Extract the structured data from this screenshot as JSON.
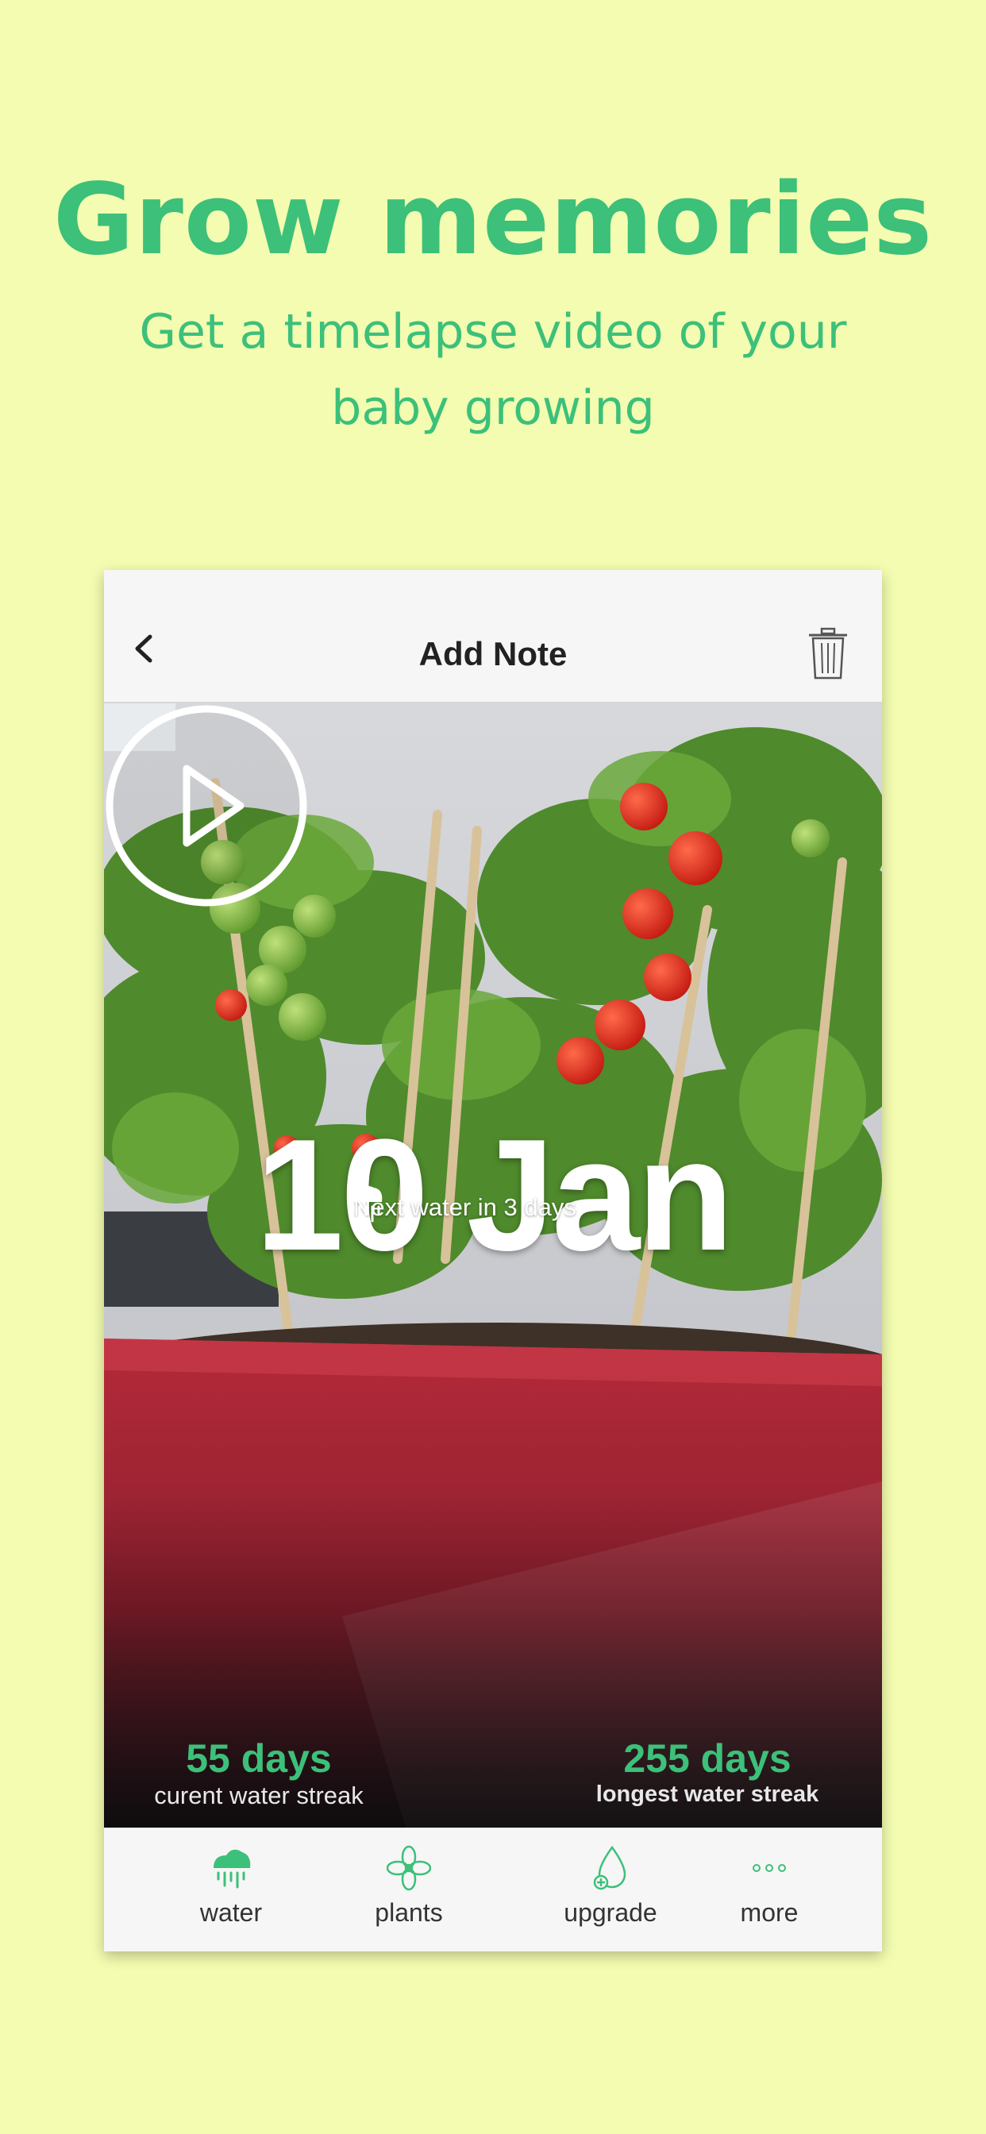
{
  "promo": {
    "headline": "Grow memories",
    "subheadline": "Get a timelapse video of your baby growing"
  },
  "navbar": {
    "title": "Add Note",
    "back_icon": "chevron-left-icon",
    "delete_icon": "trash-icon"
  },
  "plant_card": {
    "date": "10 Jan",
    "next_water": "Next water in 3 days",
    "next_water_icon": "rain-cloud-icon",
    "play_icon": "play-icon"
  },
  "streaks": {
    "current": {
      "value": "55 days",
      "label": "curent water streak"
    },
    "longest": {
      "value": "255 days",
      "label": "longest water streak"
    }
  },
  "tabs": [
    {
      "label": "water",
      "icon": "rain-cloud-icon",
      "active": true
    },
    {
      "label": "plants",
      "icon": "flower-icon"
    },
    {
      "label": "upgrade",
      "icon": "water-drop-plus-icon"
    },
    {
      "label": "more",
      "icon": "more-dots-icon"
    }
  ],
  "colors": {
    "background": "#f3fcb0",
    "accent": "#3cc07a",
    "pot": "#b52a3a"
  }
}
